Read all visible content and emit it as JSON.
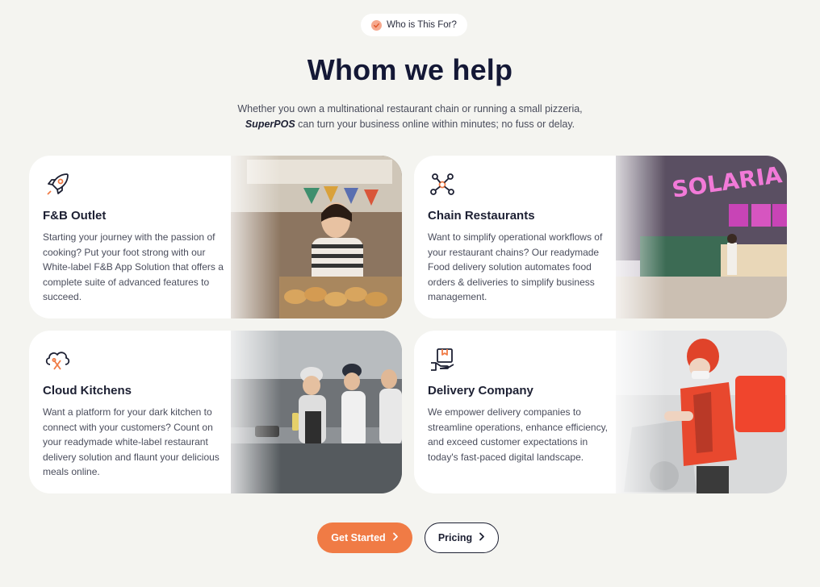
{
  "badge": {
    "label": "Who is This For?",
    "icon": "check-icon"
  },
  "heading": "Whom we help",
  "intro": {
    "line1": "Whether you own a multinational restaurant chain or running a small pizzeria,",
    "brand": "SuperPOS",
    "line2_rest": " can turn your business online within minutes; no fuss or delay."
  },
  "cards": [
    {
      "title": "F&B Outlet",
      "icon": "rocket-icon",
      "description": "Starting your journey with the passion of cooking? Put your foot strong with our White-label F&B App Solution that offers a complete suite of advanced features to succeed."
    },
    {
      "title": "Chain Restaurants",
      "icon": "network-icon",
      "description": "Want to simplify operational workflows of your restaurant chains? Our readymade Food delivery solution automates food orders & deliveries to simplify business management."
    },
    {
      "title": "Cloud Kitchens",
      "icon": "cloud-kitchen-icon",
      "description": "Want a platform for your dark kitchen to connect with your customers? Count on your readymade white-label restaurant delivery solution and flaunt your delicious meals online."
    },
    {
      "title": "Delivery Company",
      "icon": "delivery-box-icon",
      "description": "We empower delivery companies to streamline operations, enhance efficiency, and exceed customer expectations in today's fast-paced digital landscape."
    }
  ],
  "buttons": {
    "get_started": "Get Started",
    "pricing": "Pricing"
  },
  "colors": {
    "accent": "#f07b45",
    "navy": "#141836",
    "background": "#f4f4f0"
  }
}
